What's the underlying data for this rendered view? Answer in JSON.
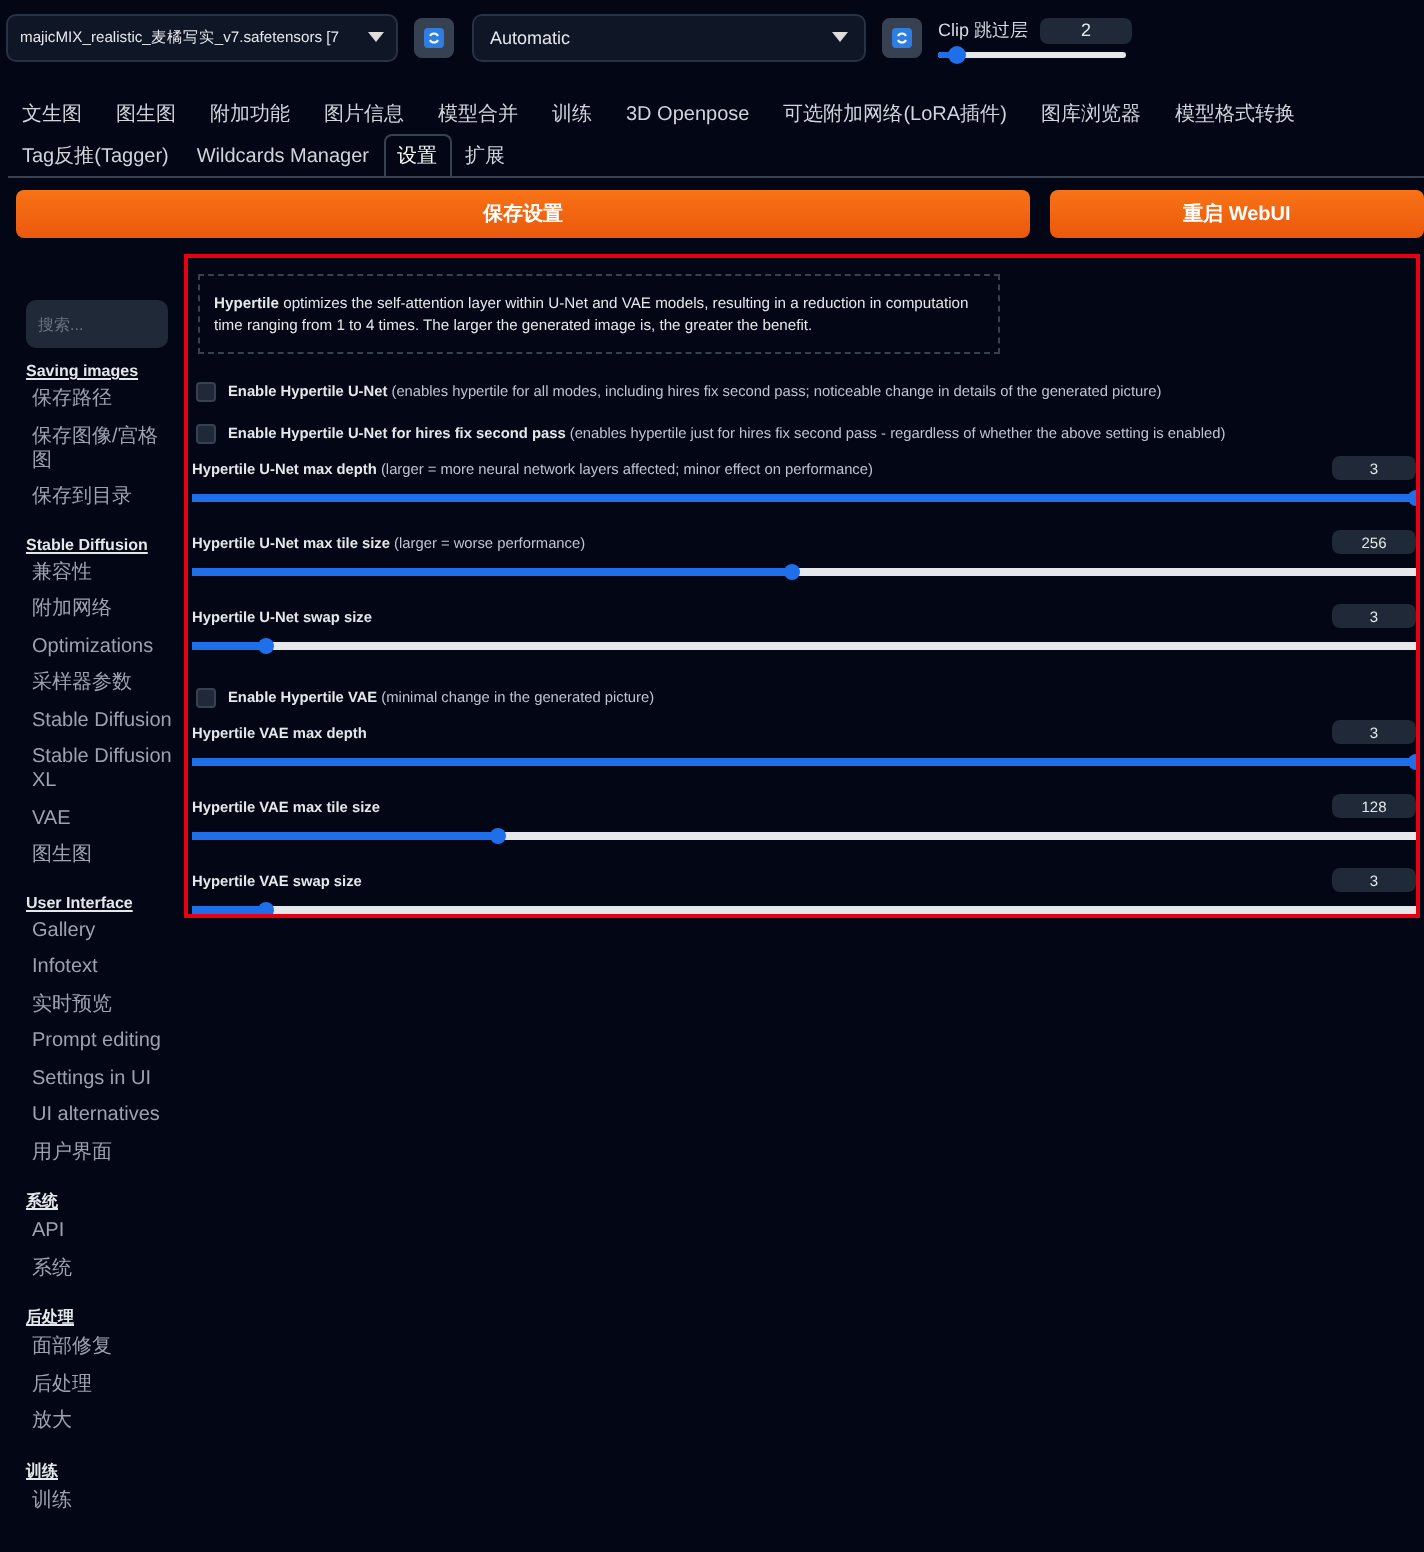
{
  "top_bar": {
    "model_select": {
      "value": "majicMIX_realistic_麦橘写实_v7.safetensors [7"
    },
    "vae_select": {
      "value": "Automatic"
    },
    "clip_skip": {
      "label": "Clip 跳过层",
      "value": "2",
      "level": 0.1
    }
  },
  "tabs": [
    [
      {
        "label": "文生图",
        "selected": false
      },
      {
        "label": "图生图",
        "selected": false
      },
      {
        "label": "附加功能",
        "selected": false
      },
      {
        "label": "图片信息",
        "selected": false
      },
      {
        "label": "模型合并",
        "selected": false
      },
      {
        "label": "训练",
        "selected": false
      },
      {
        "label": "3D Openpose",
        "selected": false
      },
      {
        "label": "可选附加网络(LoRA插件)",
        "selected": false
      },
      {
        "label": "图库浏览器",
        "selected": false
      },
      {
        "label": "模型格式转换",
        "selected": false
      }
    ],
    [
      {
        "label": "Tag反推(Tagger)",
        "selected": false
      },
      {
        "label": "Wildcards Manager",
        "selected": false
      },
      {
        "label": "设置",
        "selected": true
      },
      {
        "label": "扩展",
        "selected": false
      }
    ]
  ],
  "buttons": [
    {
      "label": "保存设置"
    },
    {
      "label": "重启 WebUI"
    }
  ],
  "sidebar": {
    "search": {
      "placeholder": "搜索..."
    },
    "groups": [
      {
        "title": "Saving images",
        "items": [
          "保存路径",
          "保存图像/宫格图",
          "保存到目录"
        ]
      },
      {
        "title": "Stable Diffusion",
        "items": [
          "兼容性",
          "附加网络",
          "Optimizations",
          "采样器参数",
          "Stable Diffusion",
          "Stable Diffusion XL",
          "VAE",
          "图生图"
        ]
      },
      {
        "title": "User Interface",
        "items": [
          "Gallery",
          "Infotext",
          "实时预览",
          "Prompt editing",
          "Settings in UI",
          "UI alternatives",
          "用户界面"
        ]
      },
      {
        "title": "系统",
        "items": [
          "API",
          "系统"
        ]
      },
      {
        "title": "后处理",
        "items": [
          "面部修复",
          "后处理",
          "放大"
        ]
      },
      {
        "title": "训练",
        "items": [
          "训练"
        ]
      }
    ]
  },
  "panel": {
    "info": "**Hypertile** optimizes the self-attention layer within U-Net and VAE models, resulting in a reduction in computation time ranging from 1 to 4 times. The larger the generated image is, the greater the benefit.",
    "settings": [
      {
        "kind": "checkbox",
        "label": "**Enable Hypertile U-Net** (enables hypertile for all modes, including hires fix second pass; noticeable change in details of the generated picture)",
        "checked": false
      },
      {
        "kind": "checkbox",
        "label": "**Enable Hypertile U-Net for hires fix second pass** (enables hypertile just for hires fix second pass - regardless of whether the above setting is enabled)",
        "checked": false
      },
      {
        "kind": "slider",
        "label": "**Hypertile U-Net max depth** (larger = more neural network layers affected; minor effect on performance)",
        "value": "3",
        "level": 1
      },
      {
        "kind": "slider",
        "label": "**Hypertile U-Net max tile size** (larger = worse performance)",
        "value": "256",
        "level": 0.49
      },
      {
        "kind": "slider",
        "label": "**Hypertile U-Net swap size**",
        "value": "3",
        "level": 0.06
      },
      {
        "kind": "checkbox",
        "label": "**Enable Hypertile VAE** (minimal change in the generated picture)",
        "checked": false
      },
      {
        "kind": "slider",
        "label": "**Hypertile VAE max depth**",
        "value": "3",
        "level": 1
      },
      {
        "kind": "slider",
        "label": "**Hypertile VAE max tile size**",
        "value": "128",
        "level": 0.25
      },
      {
        "kind": "slider",
        "label": "**Hypertile VAE swap size**",
        "value": "3",
        "level": 0.06
      }
    ]
  }
}
